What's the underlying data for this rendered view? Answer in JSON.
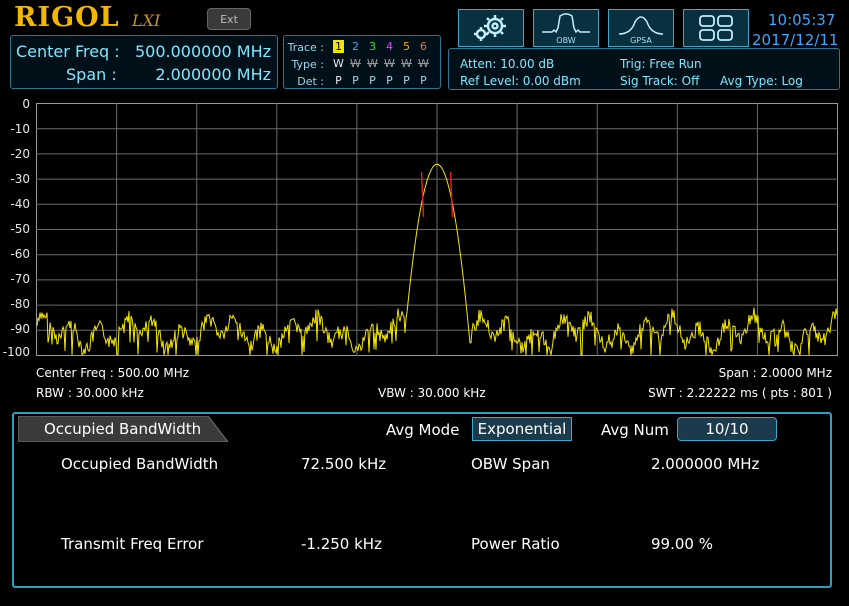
{
  "brand": {
    "logo": "RIGOL",
    "lxi": "LXI"
  },
  "header": {
    "ext_label": "Ext",
    "obw_label": "OBW",
    "gpsa_label": "GPSA",
    "time": "10:05:37",
    "date": "2017/12/11"
  },
  "freq": {
    "center_label": "Center Freq :",
    "center_value": "500.000000 MHz",
    "span_label": "Span :",
    "span_value": "2.000000 MHz"
  },
  "trace": {
    "trace_label": "Trace :",
    "type_label": "Type :",
    "det_label": "Det :",
    "numbers": [
      "1",
      "2",
      "3",
      "4",
      "5",
      "6"
    ],
    "colors": [
      "#f5e600",
      "#3aa8ff",
      "#2ee62e",
      "#e040fb",
      "#f5a623",
      "#f5713a"
    ],
    "types": [
      "W",
      "W",
      "W",
      "W",
      "W",
      "W"
    ],
    "dets": [
      "P",
      "P",
      "P",
      "P",
      "P",
      "P"
    ]
  },
  "status": {
    "atten": "Atten: 10.00 dB",
    "ref_level": "Ref Level: 0.00 dBm",
    "trig": "Trig: Free Run",
    "sig_track": "Sig Track: Off",
    "avg_type": "Avg Type: Log"
  },
  "plot": {
    "center_freq": "Center Freq : 500.00 MHz",
    "span": "Span : 2.0000 MHz",
    "rbw": "RBW : 30.000 kHz",
    "vbw": "VBW : 30.000 kHz",
    "swt": "SWT : 2.22222 ms ( pts : 801 )"
  },
  "chart_data": {
    "type": "line",
    "y_ticks": [
      "0",
      "-10",
      "-20",
      "-30",
      "-40",
      "-50",
      "-60",
      "-70",
      "-80",
      "-90",
      "-100"
    ],
    "ylim": [
      -100,
      0
    ],
    "xlim": [
      499.0,
      501.0
    ],
    "grid": true,
    "trace_color": "#f5e600",
    "marker_color": "#e02020",
    "peak": {
      "x": 500.0,
      "y": -24
    },
    "markers": [
      {
        "x": 499.96375,
        "y": -40
      },
      {
        "x": 500.03625,
        "y": -40
      }
    ]
  },
  "measure": {
    "tab_label": "Occupied BandWidth",
    "avg_mode_label": "Avg Mode",
    "avg_mode_value": "Exponential",
    "avg_num_label": "Avg Num",
    "avg_num_value": "10/10",
    "obw_label": "Occupied BandWidth",
    "obw_value": "72.500 kHz",
    "obw_span_label": "OBW Span",
    "obw_span_value": "2.000000 MHz",
    "tfe_label": "Transmit Freq Error",
    "tfe_value": "-1.250 kHz",
    "power_ratio_label": "Power Ratio",
    "power_ratio_value": "99.00 %"
  }
}
